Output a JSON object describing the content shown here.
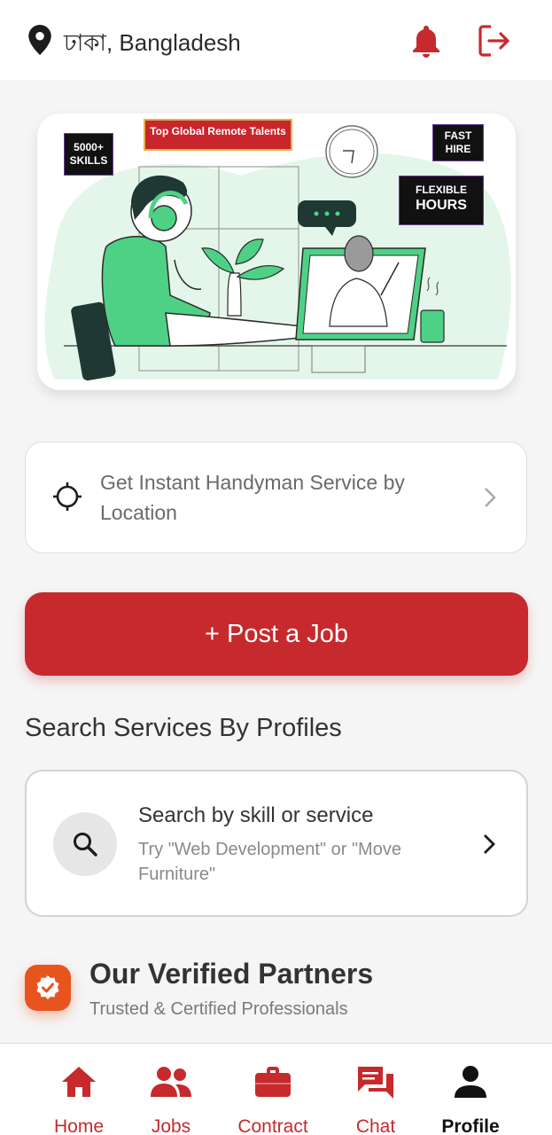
{
  "header": {
    "location": "ঢাকা, Bangladesh",
    "icons": {
      "location": "map-pin-icon",
      "notifications": "bell-icon",
      "logout": "logout-icon"
    }
  },
  "banner": {
    "tags": {
      "skills": "5000+ SKILLS",
      "talents": "Top Global Remote Talents",
      "fast": "FAST HIRE",
      "flexible_1": "FLEXIBLE",
      "flexible_2": "HOURS"
    }
  },
  "location_card": {
    "text": "Get Instant Handyman Service by Location",
    "icon": "crosshair-icon"
  },
  "post_job": {
    "label": "+ Post a Job"
  },
  "search_section": {
    "title": "Search Services By Profiles",
    "card_title": "Search by skill or service",
    "card_subtitle": "Try \"Web Development\" or \"Move Furniture\"",
    "icon": "search-icon"
  },
  "partners": {
    "title": "Our Verified Partners",
    "subtitle": "Trusted & Certified Professionals",
    "icon": "verified-badge-icon"
  },
  "nav": {
    "items": [
      {
        "label": "Home",
        "icon": "home-icon"
      },
      {
        "label": "Jobs",
        "icon": "people-icon"
      },
      {
        "label": "Contract",
        "icon": "briefcase-icon"
      },
      {
        "label": "Chat",
        "icon": "chat-icon"
      },
      {
        "label": "Profile",
        "icon": "person-icon"
      }
    ],
    "active": "Profile"
  },
  "colors": {
    "primary": "#c62a2c",
    "accent_green": "#4fd185",
    "badge_orange": "#e8541e"
  }
}
